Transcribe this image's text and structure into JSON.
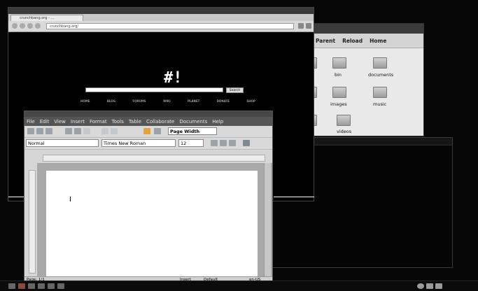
{
  "browser": {
    "tab_title": "crunchbang.org - ...",
    "url": "crunchbang.org/",
    "logo": "#!",
    "search_placeholder": "",
    "search_button": "Search",
    "nav": [
      "HOME",
      "BLOG",
      "FORUMS",
      "WIKI",
      "PLANET",
      "DONATE",
      "SHOP"
    ]
  },
  "file_manager": {
    "toolbar": {
      "parent": "Parent",
      "reload": "Reload",
      "home": "Home"
    },
    "items": [
      {
        "label": "bin"
      },
      {
        "label": "documents"
      },
      {
        "label": "images"
      },
      {
        "label": "music"
      },
      {
        "label": "videos"
      }
    ]
  },
  "writer": {
    "menu": [
      "File",
      "Edit",
      "View",
      "Insert",
      "Format",
      "Tools",
      "Table",
      "Collaborate",
      "Documents",
      "Help"
    ],
    "zoom": "Page Width",
    "paragraph_style": "Normal",
    "font_name": "Times New Roman",
    "font_size": "12",
    "status": {
      "page": "Page: 1/1",
      "insert": "Insert",
      "default": "Default",
      "lang": "en-US"
    }
  },
  "colors": {
    "desktop": "#070707",
    "accent": "#3b3b3b"
  }
}
